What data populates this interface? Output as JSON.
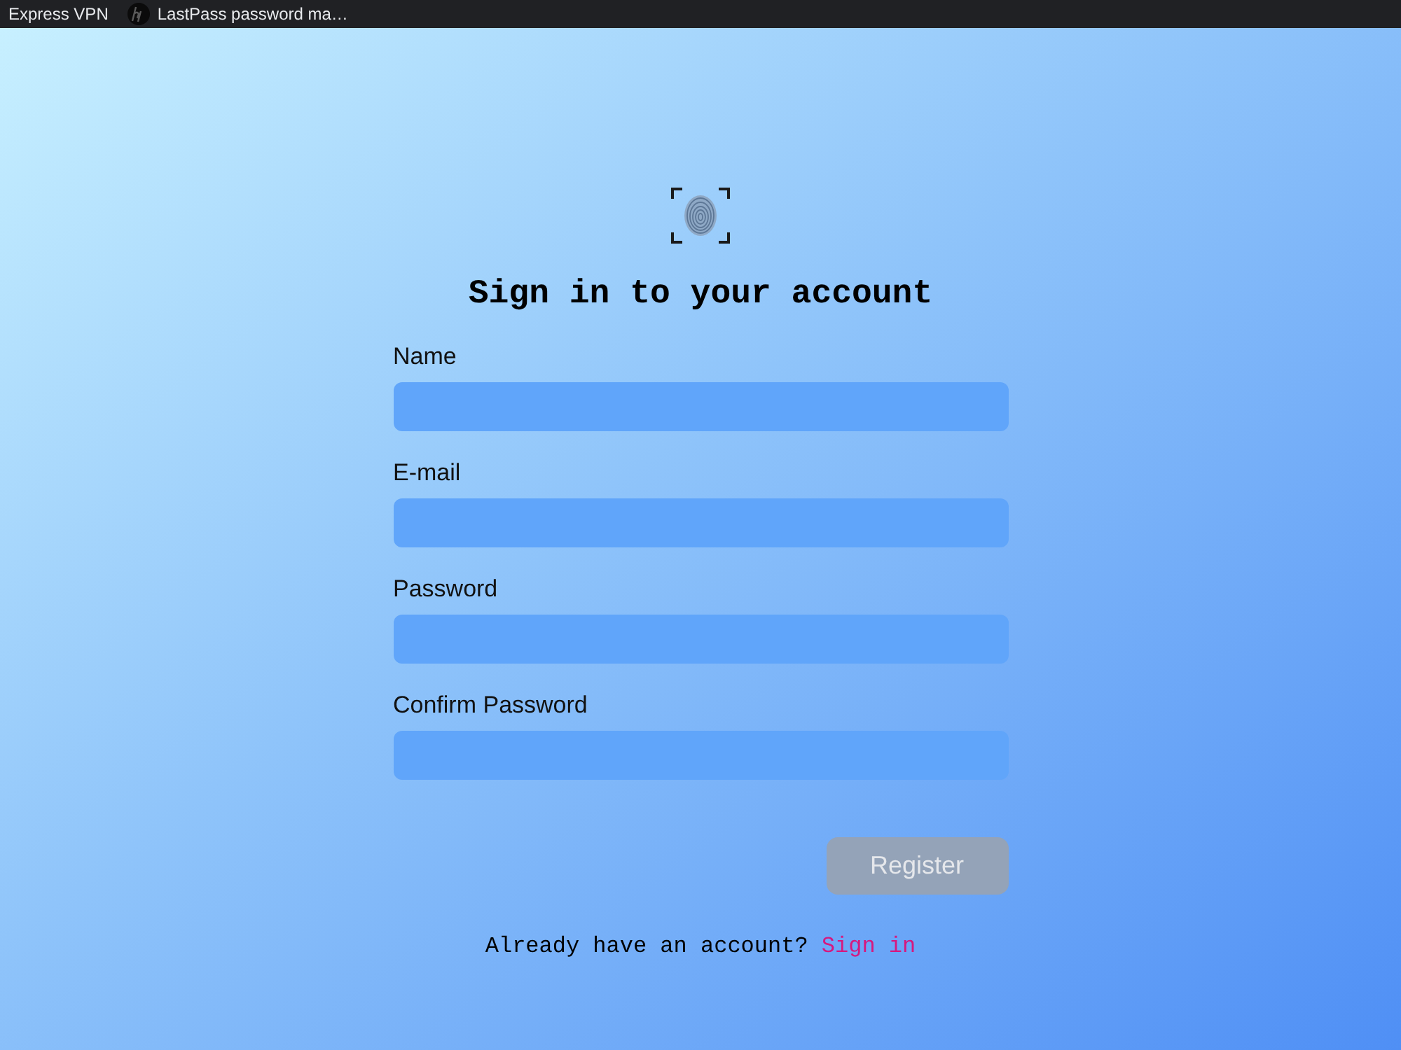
{
  "bookmarks_bar": {
    "items": [
      {
        "label": "Express VPN",
        "kind": "plain"
      },
      {
        "label": "LastPass password ma…",
        "kind": "favicon"
      }
    ]
  },
  "form": {
    "title": "Sign in to your account",
    "fields": [
      {
        "label": "Name"
      },
      {
        "label": "E-mail"
      },
      {
        "label": "Password"
      },
      {
        "label": "Confirm Password"
      }
    ],
    "submit": {
      "label": "Register",
      "disabled": true
    },
    "footer": {
      "text": "Already have an account?",
      "link": "Sign in"
    }
  }
}
